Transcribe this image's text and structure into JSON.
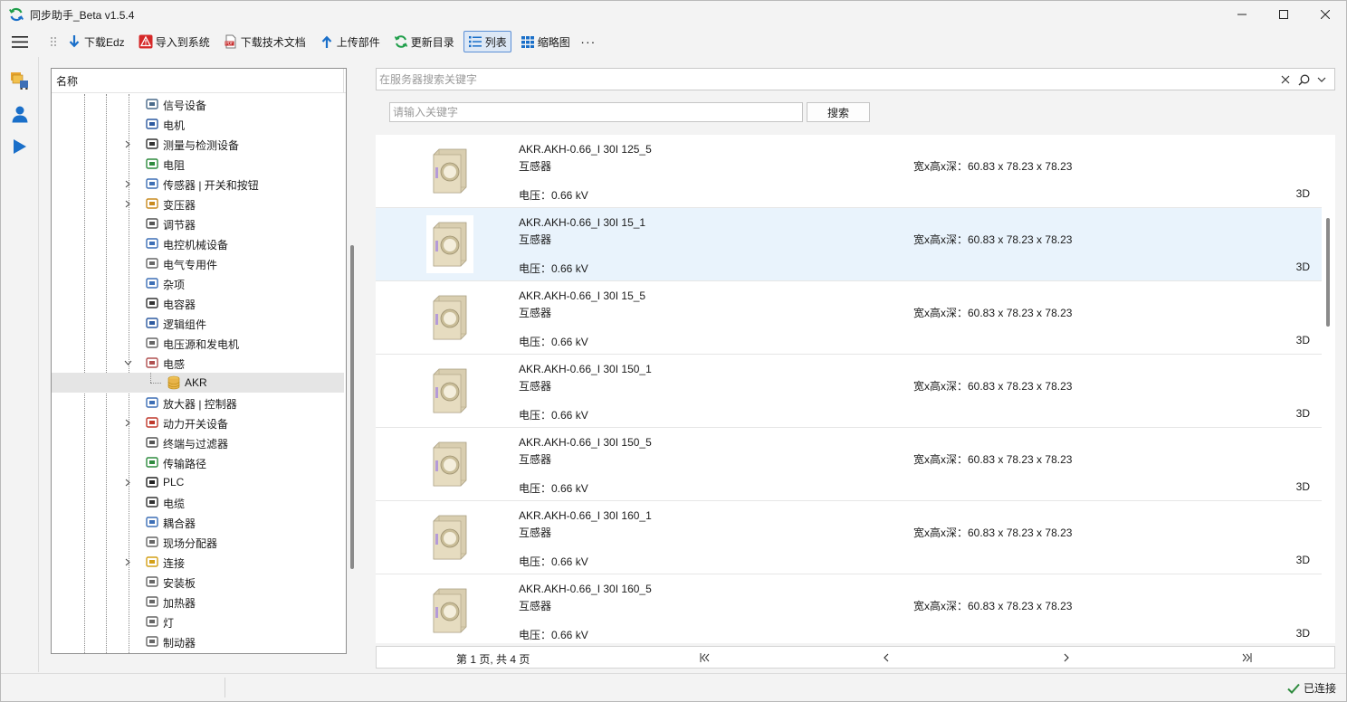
{
  "window": {
    "title": "同步助手_Beta v1.5.4"
  },
  "toolbar": {
    "items": [
      {
        "label": "下载Edz",
        "icon": "download-arrow-icon",
        "active": false
      },
      {
        "label": "导入到系统",
        "icon": "warning-import-icon",
        "active": false
      },
      {
        "label": "下载技术文档",
        "icon": "pdf-document-icon",
        "active": false
      },
      {
        "label": "上传部件",
        "icon": "upload-arrow-icon",
        "active": false
      },
      {
        "label": "更新目录",
        "icon": "refresh-icon",
        "active": false
      },
      {
        "label": "列表",
        "icon": "list-view-icon",
        "active": true
      },
      {
        "label": "缩略图",
        "icon": "thumbnail-grid-icon",
        "active": false
      }
    ],
    "more": "···"
  },
  "tree": {
    "header": "名称",
    "items": [
      {
        "label": "信号设备",
        "icon": "signal-device-icon",
        "expandable": false
      },
      {
        "label": "电机",
        "icon": "motor-icon",
        "expandable": false
      },
      {
        "label": "测量与检测设备",
        "icon": "measurement-icon",
        "expandable": true
      },
      {
        "label": "电阻",
        "icon": "resistor-icon",
        "expandable": false
      },
      {
        "label": "传感器 | 开关和按钮",
        "icon": "sensor-icon",
        "expandable": true
      },
      {
        "label": "变压器",
        "icon": "transformer-icon",
        "expandable": true
      },
      {
        "label": "调节器",
        "icon": "regulator-icon",
        "expandable": false
      },
      {
        "label": "电控机械设备",
        "icon": "electromechanical-icon",
        "expandable": false
      },
      {
        "label": "电气专用件",
        "icon": "electrical-special-icon",
        "expandable": false
      },
      {
        "label": "杂项",
        "icon": "misc-icon",
        "expandable": false
      },
      {
        "label": "电容器",
        "icon": "capacitor-icon",
        "expandable": false
      },
      {
        "label": "逻辑组件",
        "icon": "logic-component-icon",
        "expandable": false
      },
      {
        "label": "电压源和发电机",
        "icon": "voltage-source-icon",
        "expandable": false
      },
      {
        "label": "电感",
        "icon": "inductor-icon",
        "expandable": true,
        "expanded": true
      },
      {
        "label": "AKR",
        "icon": "database-icon",
        "child": true,
        "selected": true
      },
      {
        "label": "放大器 | 控制器",
        "icon": "amplifier-icon",
        "expandable": false
      },
      {
        "label": "动力开关设备",
        "icon": "power-switch-icon",
        "expandable": true
      },
      {
        "label": "终端与过滤器",
        "icon": "terminal-filter-icon",
        "expandable": false
      },
      {
        "label": "传输路径",
        "icon": "transmission-path-icon",
        "expandable": false
      },
      {
        "label": "PLC",
        "icon": "plc-icon",
        "expandable": true
      },
      {
        "label": "电缆",
        "icon": "cable-icon",
        "expandable": false
      },
      {
        "label": "耦合器",
        "icon": "coupler-icon",
        "expandable": false
      },
      {
        "label": "现场分配器",
        "icon": "field-distributor-icon",
        "expandable": false
      },
      {
        "label": "连接",
        "icon": "connection-icon",
        "expandable": true
      },
      {
        "label": "安装板",
        "icon": "mounting-plate-icon",
        "expandable": false
      },
      {
        "label": "加热器",
        "icon": "heater-icon",
        "expandable": false
      },
      {
        "label": "灯",
        "icon": "lamp-icon",
        "expandable": false
      },
      {
        "label": "制动器",
        "icon": "brake-icon",
        "expandable": false
      }
    ]
  },
  "search": {
    "server_placeholder": "在服务器搜索关键字",
    "keyword_placeholder": "请输入关键字",
    "button": "搜索"
  },
  "parts": [
    {
      "name": "AKR.AKH-0.66_I 30I 125_5",
      "type": "互感器",
      "dims": "宽x高x深：60.83 x 78.23 x 78.23",
      "voltage": "电压：0.66 kV",
      "tag": "3D",
      "selected": false
    },
    {
      "name": "AKR.AKH-0.66_I 30I 15_1",
      "type": "互感器",
      "dims": "宽x高x深：60.83 x 78.23 x 78.23",
      "voltage": "电压：0.66 kV",
      "tag": "3D",
      "selected": true
    },
    {
      "name": "AKR.AKH-0.66_I 30I 15_5",
      "type": "互感器",
      "dims": "宽x高x深：60.83 x 78.23 x 78.23",
      "voltage": "电压：0.66 kV",
      "tag": "3D",
      "selected": false
    },
    {
      "name": "AKR.AKH-0.66_I 30I 150_1",
      "type": "互感器",
      "dims": "宽x高x深：60.83 x 78.23 x 78.23",
      "voltage": "电压：0.66 kV",
      "tag": "3D",
      "selected": false
    },
    {
      "name": "AKR.AKH-0.66_I 30I 150_5",
      "type": "互感器",
      "dims": "宽x高x深：60.83 x 78.23 x 78.23",
      "voltage": "电压：0.66 kV",
      "tag": "3D",
      "selected": false
    },
    {
      "name": "AKR.AKH-0.66_I 30I 160_1",
      "type": "互感器",
      "dims": "宽x高x深：60.83 x 78.23 x 78.23",
      "voltage": "电压：0.66 kV",
      "tag": "3D",
      "selected": false
    },
    {
      "name": "AKR.AKH-0.66_I 30I 160_5",
      "type": "互感器",
      "dims": "宽x高x深：60.83 x 78.23 x 78.23",
      "voltage": "电压：0.66 kV",
      "tag": "3D",
      "selected": false
    }
  ],
  "pager": {
    "info": "第 1 页, 共 4 页"
  },
  "status": {
    "connection": "已连接"
  },
  "colors": {
    "accent": "#1a6fc9",
    "selection": "#e9f3fc",
    "ok": "#2e8b3e"
  }
}
